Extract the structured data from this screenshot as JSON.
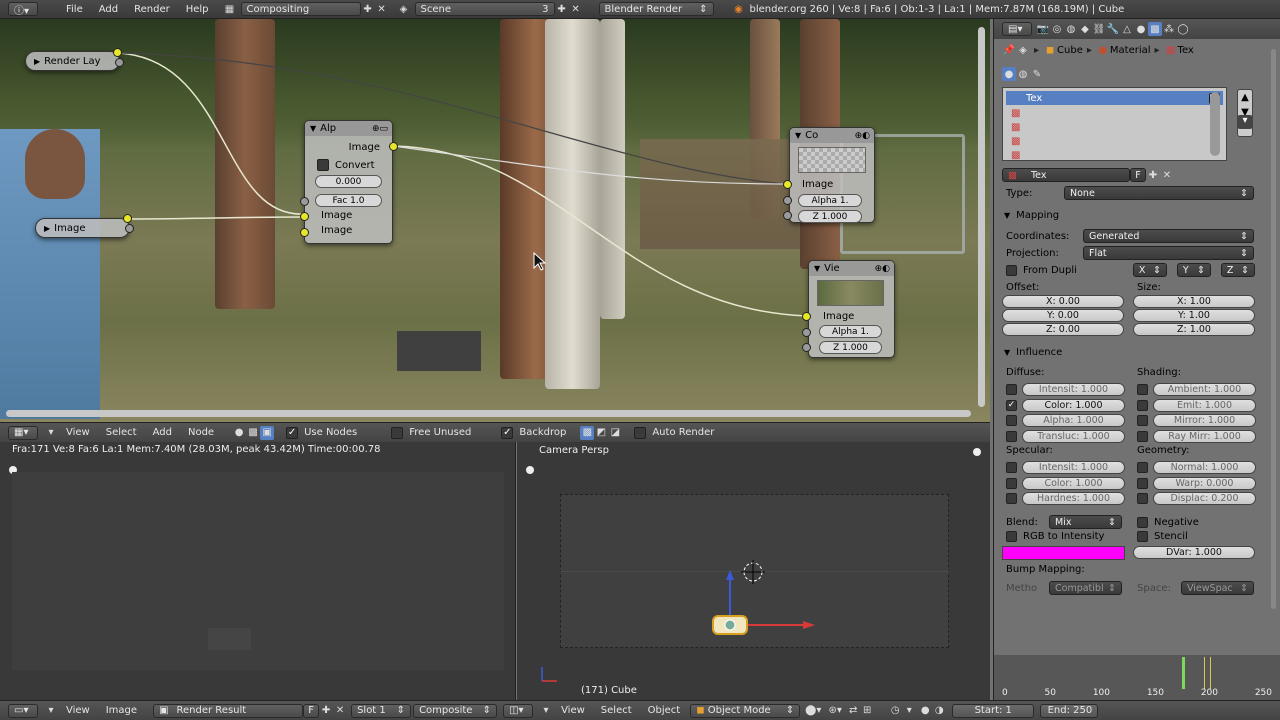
{
  "topbar": {
    "menus": [
      "File",
      "Add",
      "Render",
      "Help"
    ],
    "screen": "Compositing",
    "scene": "Scene",
    "scene_num": "3",
    "engine": "Blender Render",
    "info": "blender.org 260 | Ve:8 | Fa:6 | Ob:1-3 | La:1 | Mem:7.87M (168.19M) | Cube"
  },
  "nodes": {
    "render_layer": "Render Lay",
    "image_in": "Image",
    "alpha": {
      "title": "Alp",
      "out": "Image",
      "convert": "Convert",
      "value": "0.000",
      "fac": "Fac 1.0",
      "in1": "Image",
      "in2": "Image"
    },
    "composite": {
      "title": "Co",
      "in1": "Image",
      "in2": "Alpha 1.",
      "in3": "Z 1.000"
    },
    "viewer": {
      "title": "Vie",
      "in1": "Image",
      "in2": "Alpha 1.",
      "in3": "Z 1.000"
    }
  },
  "node_header": {
    "menus": [
      "View",
      "Select",
      "Add",
      "Node"
    ],
    "use_nodes": "Use Nodes",
    "free_unused": "Free Unused",
    "backdrop": "Backdrop",
    "auto_render": "Auto Render"
  },
  "image_editor": {
    "status": "Fra:171  Ve:8 Fa:6 La:1 Mem:7.40M (28.03M, peak 43.42M) Time:00:00.78"
  },
  "viewport": {
    "label": "Camera Persp",
    "object": "(171) Cube"
  },
  "props": {
    "breadcrumb": [
      "Cube",
      "Material",
      "Tex"
    ],
    "tex_list": [
      "Tex"
    ],
    "tex_name": "Tex",
    "tex_f": "F",
    "type_label": "Type:",
    "type_value": "None",
    "mapping": "Mapping",
    "coords_label": "Coordinates:",
    "coords_value": "Generated",
    "proj_label": "Projection:",
    "proj_value": "Flat",
    "from_dupli": "From Dupli",
    "axes": [
      "X",
      "Y",
      "Z"
    ],
    "offset_label": "Offset:",
    "size_label": "Size:",
    "offset": [
      "X: 0.00",
      "Y: 0.00",
      "Z: 0.00"
    ],
    "size": [
      "X: 1.00",
      "Y: 1.00",
      "Z: 1.00"
    ],
    "influence": "Influence",
    "diffuse": "Diffuse:",
    "shading": "Shading:",
    "diffuse_items": [
      "Intensit: 1.000",
      "Color: 1.000",
      "Alpha: 1.000",
      "Transluc: 1.000"
    ],
    "shading_items": [
      "Ambient: 1.000",
      "Emit: 1.000",
      "Mirror: 1.000",
      "Ray Mirr: 1.000"
    ],
    "specular": "Specular:",
    "geometry": "Geometry:",
    "specular_items": [
      "Intensit: 1.000",
      "Color: 1.000",
      "Hardnes: 1.000"
    ],
    "geometry_items": [
      "Normal: 1.000",
      "Warp: 0.000",
      "Displac: 0.200"
    ],
    "blend_label": "Blend:",
    "blend_value": "Mix",
    "negative": "Negative",
    "rgb_intensity": "RGB to Intensity",
    "stencil": "Stencil",
    "dvar": "DVar: 1.000",
    "bump": "Bump Mapping:",
    "method_label": "Metho",
    "method_value": "Compatibl",
    "space_label": "Space:",
    "space_value": "ViewSpac",
    "color_swatch": "#ff00ff"
  },
  "timeline": {
    "ticks": [
      "0",
      "50",
      "100",
      "150",
      "200",
      "250"
    ]
  },
  "bottom": {
    "menus_left": [
      "View",
      "Image"
    ],
    "render_result": "Render Result",
    "f": "F",
    "slot": "Slot 1",
    "composite": "Composite",
    "menus_mid": [
      "View",
      "Select",
      "Object"
    ],
    "mode": "Object Mode",
    "start": "Start: 1",
    "end": "End: 250"
  }
}
